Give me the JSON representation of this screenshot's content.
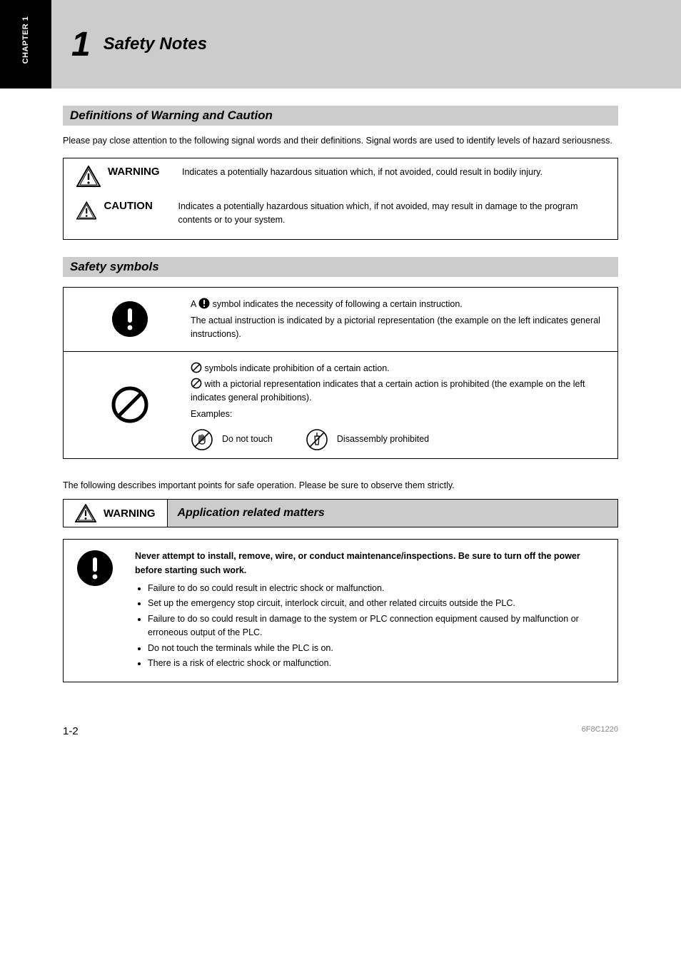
{
  "chapter": {
    "tab_label": "CHAPTER 1",
    "number": "1",
    "title": "Safety Notes"
  },
  "sections": {
    "definitions": {
      "heading": "Definitions of Warning and Caution",
      "intro": "Please pay close attention to the following signal words and their definitions. Signal words are used to identify levels of hazard seriousness.",
      "warning": {
        "label": "WARNING",
        "text": "Indicates a potentially hazardous situation which, if not avoided, could result in bodily injury."
      },
      "caution": {
        "label": "CAUTION",
        "text": "Indicates a potentially hazardous situation which, if not avoided, may result in damage to the program contents or to your system."
      }
    },
    "safety_symbols": {
      "heading": "Safety symbols",
      "mandatory": {
        "intro_a": "A ",
        "intro_b": " symbol indicates the necessity of following a certain instruction.",
        "detail": "The actual instruction is indicated by a pictorial representation (the example on the left indicates general instructions)."
      },
      "prohibit": {
        "intro": "  symbols indicate prohibition of a certain action.",
        "detail": "  with a pictorial representation indicates that a certain action is prohibited (the example on the left indicates general prohibitions).",
        "examples_label": "Examples:",
        "ex1": "Do not touch",
        "ex2": "Disassembly prohibited"
      }
    },
    "app_matters": {
      "note": "The following describes important points for safe operation. Please be sure to observe them strictly.",
      "banner_label": "WARNING",
      "banner_title": "Application related matters",
      "box": {
        "lead": "Never attempt to install, remove, wire, or conduct maintenance/inspections. Be sure to turn off the power before starting such work.",
        "items": [
          "Failure to do so could result in electric shock or malfunction.",
          "Set up the emergency stop circuit, interlock circuit, and other related circuits outside the PLC.",
          "Failure to do so could result in damage to the system or PLC connection equipment caused by malfunction or erroneous output of the PLC.",
          "Do not touch the terminals while the PLC is on.",
          "There is a risk of electric shock or malfunction."
        ]
      }
    }
  },
  "footer": {
    "page_num": "1-2",
    "doc_ref": "6F8C1220"
  }
}
